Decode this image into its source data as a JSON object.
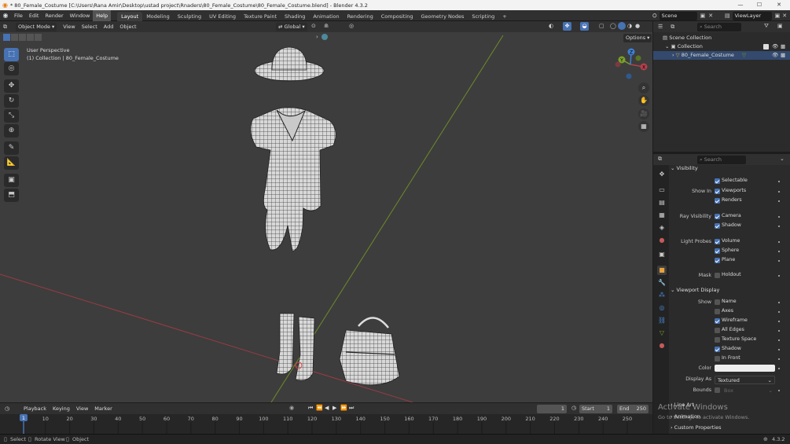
{
  "window": {
    "title": "* 80_Female_Costume [C:\\Users\\Rana Amir\\Desktop\\ustad project\\Rnaders\\80_Female_Costume\\80_Female_Costume.blend] - Blender 4.3.2",
    "minimize": "—",
    "maximize": "☐",
    "close": "✕"
  },
  "menus": [
    "File",
    "Edit",
    "Render",
    "Window",
    "Help"
  ],
  "workspaces": [
    "Layout",
    "Modeling",
    "Sculpting",
    "UV Editing",
    "Texture Paint",
    "Shading",
    "Animation",
    "Rendering",
    "Compositing",
    "Geometry Nodes",
    "Scripting"
  ],
  "workspace_add": "+",
  "scene": {
    "name": "Scene",
    "view_layer": "ViewLayer"
  },
  "viewport": {
    "mode": "Object Mode",
    "menu": [
      "View",
      "Select",
      "Add",
      "Object"
    ],
    "orientation": "Global",
    "options": "Options",
    "info_line1": "User Perspective",
    "info_line2": "(1) Collection | 80_Female_Costume",
    "gizmo": {
      "x": "X",
      "y": "Y",
      "z": "Z"
    }
  },
  "outliner": {
    "search_placeholder": "Search",
    "root": "Scene Collection",
    "collection": "Collection",
    "object": "80_Female_Costume"
  },
  "properties": {
    "search_placeholder": "Search",
    "visibility": {
      "title": "Visibility",
      "selectable": "Selectable",
      "show_in": "Show In",
      "viewports": "Viewports",
      "renders": "Renders",
      "ray_visibility": "Ray Visibility",
      "camera": "Camera",
      "shadow": "Shadow",
      "light_probes": "Light Probes",
      "volume": "Volume",
      "sphere": "Sphere",
      "plane": "Plane",
      "mask": "Mask",
      "holdout": "Holdout"
    },
    "viewport_display": {
      "title": "Viewport Display",
      "show": "Show",
      "name": "Name",
      "axes": "Axes",
      "wireframe": "Wireframe",
      "all_edges": "All Edges",
      "texture_space": "Texture Space",
      "shadow": "Shadow",
      "in_front": "In Front",
      "color": "Color",
      "color_value": "#ededed",
      "display_as": "Display As",
      "display_as_value": "Textured",
      "bounds": "Bounds",
      "bounds_value": "Box"
    },
    "line_art": "Line Art",
    "animation": "Animation",
    "custom_properties": "Custom Properties"
  },
  "timeline": {
    "menus": [
      "Playback",
      "Keying",
      "View",
      "Marker"
    ],
    "current_frame": "1",
    "start_label": "Start",
    "start": "1",
    "end_label": "End",
    "end": "250",
    "ruler": [
      "1",
      "10",
      "20",
      "30",
      "40",
      "50",
      "60",
      "70",
      "80",
      "90",
      "100",
      "110",
      "120",
      "130",
      "140",
      "150",
      "160",
      "170",
      "180",
      "190",
      "200",
      "210",
      "220",
      "230",
      "240",
      "250"
    ]
  },
  "watermark": {
    "line1": "Activate Windows",
    "line2": "Go to Settings to activate Windows."
  },
  "statusbar": {
    "select": "Select",
    "rotate": "Rotate View",
    "object": "Object",
    "version": "4.3.2"
  },
  "colors": {
    "accent": "#4772b3",
    "x_axis": "#b3404c",
    "y_axis": "#7ba02b",
    "z_axis": "#3f7fd1",
    "object_icon": "#e8a23c"
  }
}
